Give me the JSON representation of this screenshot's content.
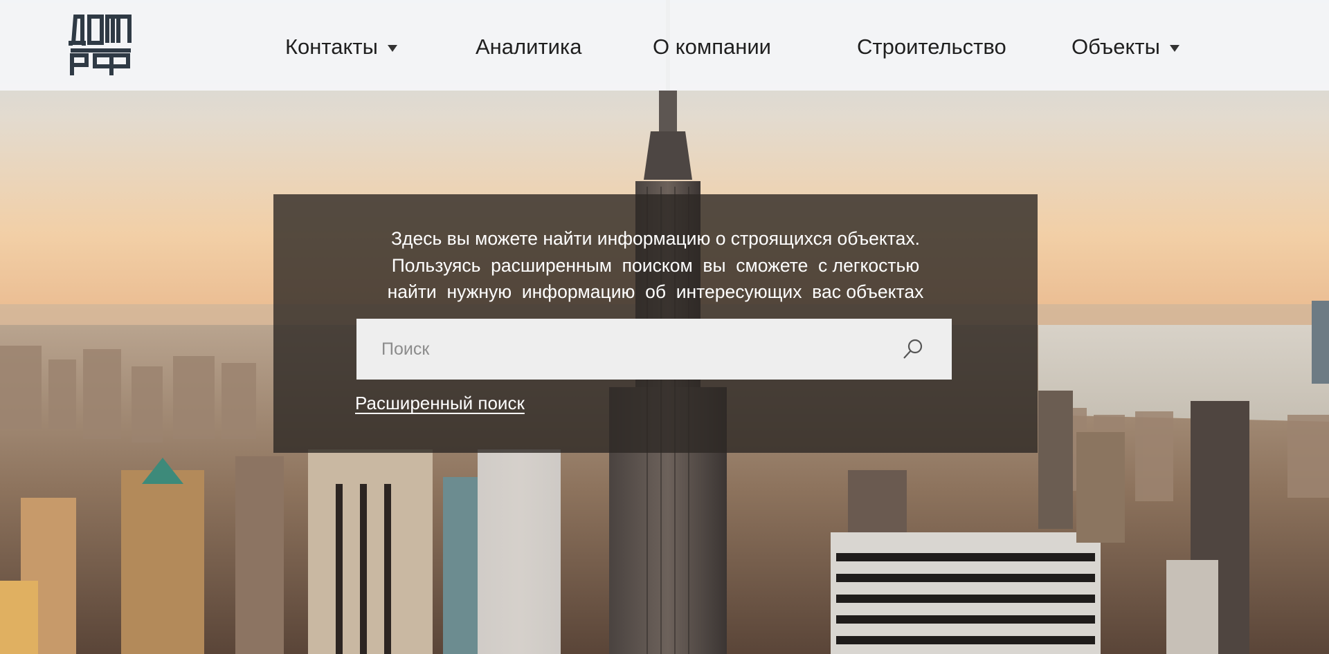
{
  "brand": {
    "logo_alt": "ДОМ.РФ",
    "logo_color": "#2f3a45"
  },
  "nav": {
    "items": [
      {
        "label": "Контакты",
        "has_dropdown": true
      },
      {
        "label": "Аналитика",
        "has_dropdown": false
      },
      {
        "label": "О компании",
        "has_dropdown": false
      },
      {
        "label": "Строительство",
        "has_dropdown": false
      },
      {
        "label": "Объекты",
        "has_dropdown": true
      }
    ]
  },
  "search_panel": {
    "intro_lines": [
      "Здесь вы можете найти информацию о строящихся объектах.",
      "Пользуясь  расширенным  поиском  вы  сможете  с легкостью",
      "найти  нужную  информацию  об  интересующих  вас объектах"
    ],
    "search": {
      "placeholder": "Поиск",
      "value": "",
      "icon": "search-icon"
    },
    "advanced_search_label": "Расширенный поиск"
  },
  "colors": {
    "header_bg": "#f4f6f8",
    "panel_bg": "rgba(45,40,36,0.80)",
    "search_bg": "#eeeeee",
    "text_light": "#ffffff"
  }
}
